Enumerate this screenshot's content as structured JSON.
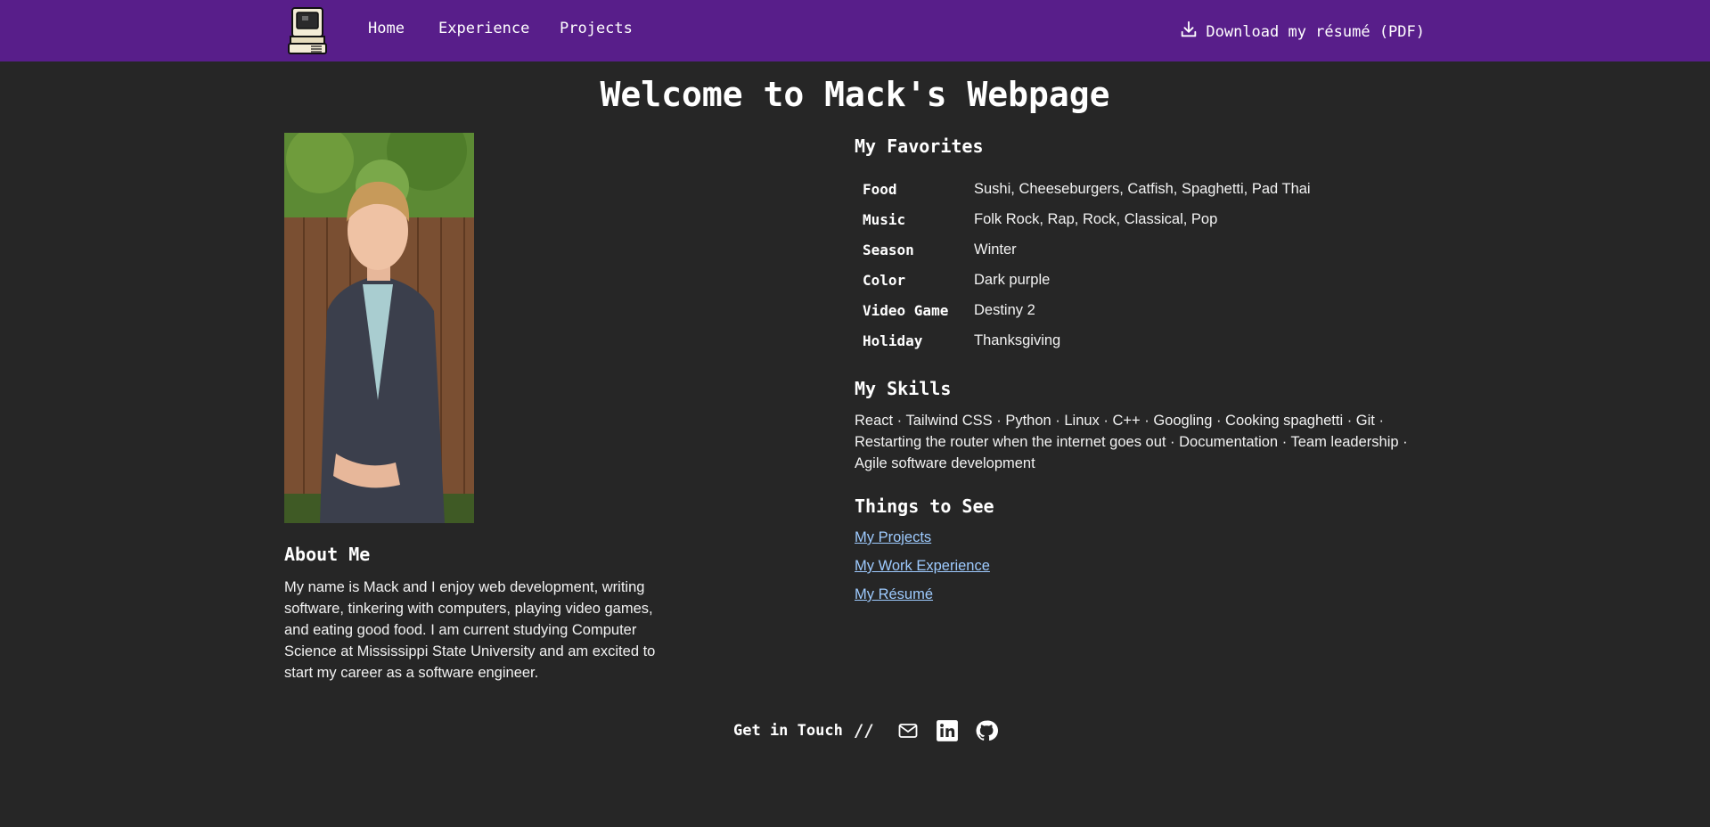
{
  "nav": {
    "links": [
      "Home",
      "Experience",
      "Projects"
    ],
    "resume_label": "Download my résumé (PDF)"
  },
  "title": "Welcome to Mack's Webpage",
  "about": {
    "heading": "About Me",
    "text": "My name is Mack and I enjoy web development, writing software, tinkering with computers, playing video games, and eating good food. I am current studying Computer Science at Mississippi State University and am excited to start my career as a software engineer."
  },
  "favorites": {
    "heading": "My Favorites",
    "rows": [
      {
        "key": "Food",
        "value": "Sushi, Cheeseburgers, Catfish, Spaghetti, Pad Thai"
      },
      {
        "key": "Music",
        "value": "Folk Rock, Rap, Rock, Classical, Pop"
      },
      {
        "key": "Season",
        "value": "Winter"
      },
      {
        "key": "Color",
        "value": "Dark purple"
      },
      {
        "key": "Video Game",
        "value": "Destiny 2"
      },
      {
        "key": "Holiday",
        "value": "Thanksgiving"
      }
    ]
  },
  "skills": {
    "heading": "My Skills",
    "text": "React · Tailwind CSS · Python · Linux · C++ · Googling · Cooking spaghetti · Git · Restarting the router when the internet goes out · Documentation · Team leadership · Agile software development"
  },
  "things": {
    "heading": "Things to See",
    "links": [
      "My Projects",
      "My Work Experience",
      "My Résumé"
    ]
  },
  "contact": {
    "label": "Get in Touch",
    "separator": "//",
    "icons": [
      "mail-icon",
      "linkedin-icon",
      "github-icon"
    ]
  },
  "colors": {
    "nav_bg": "#581e8a",
    "page_bg": "#262626",
    "link": "#9ecbff"
  }
}
